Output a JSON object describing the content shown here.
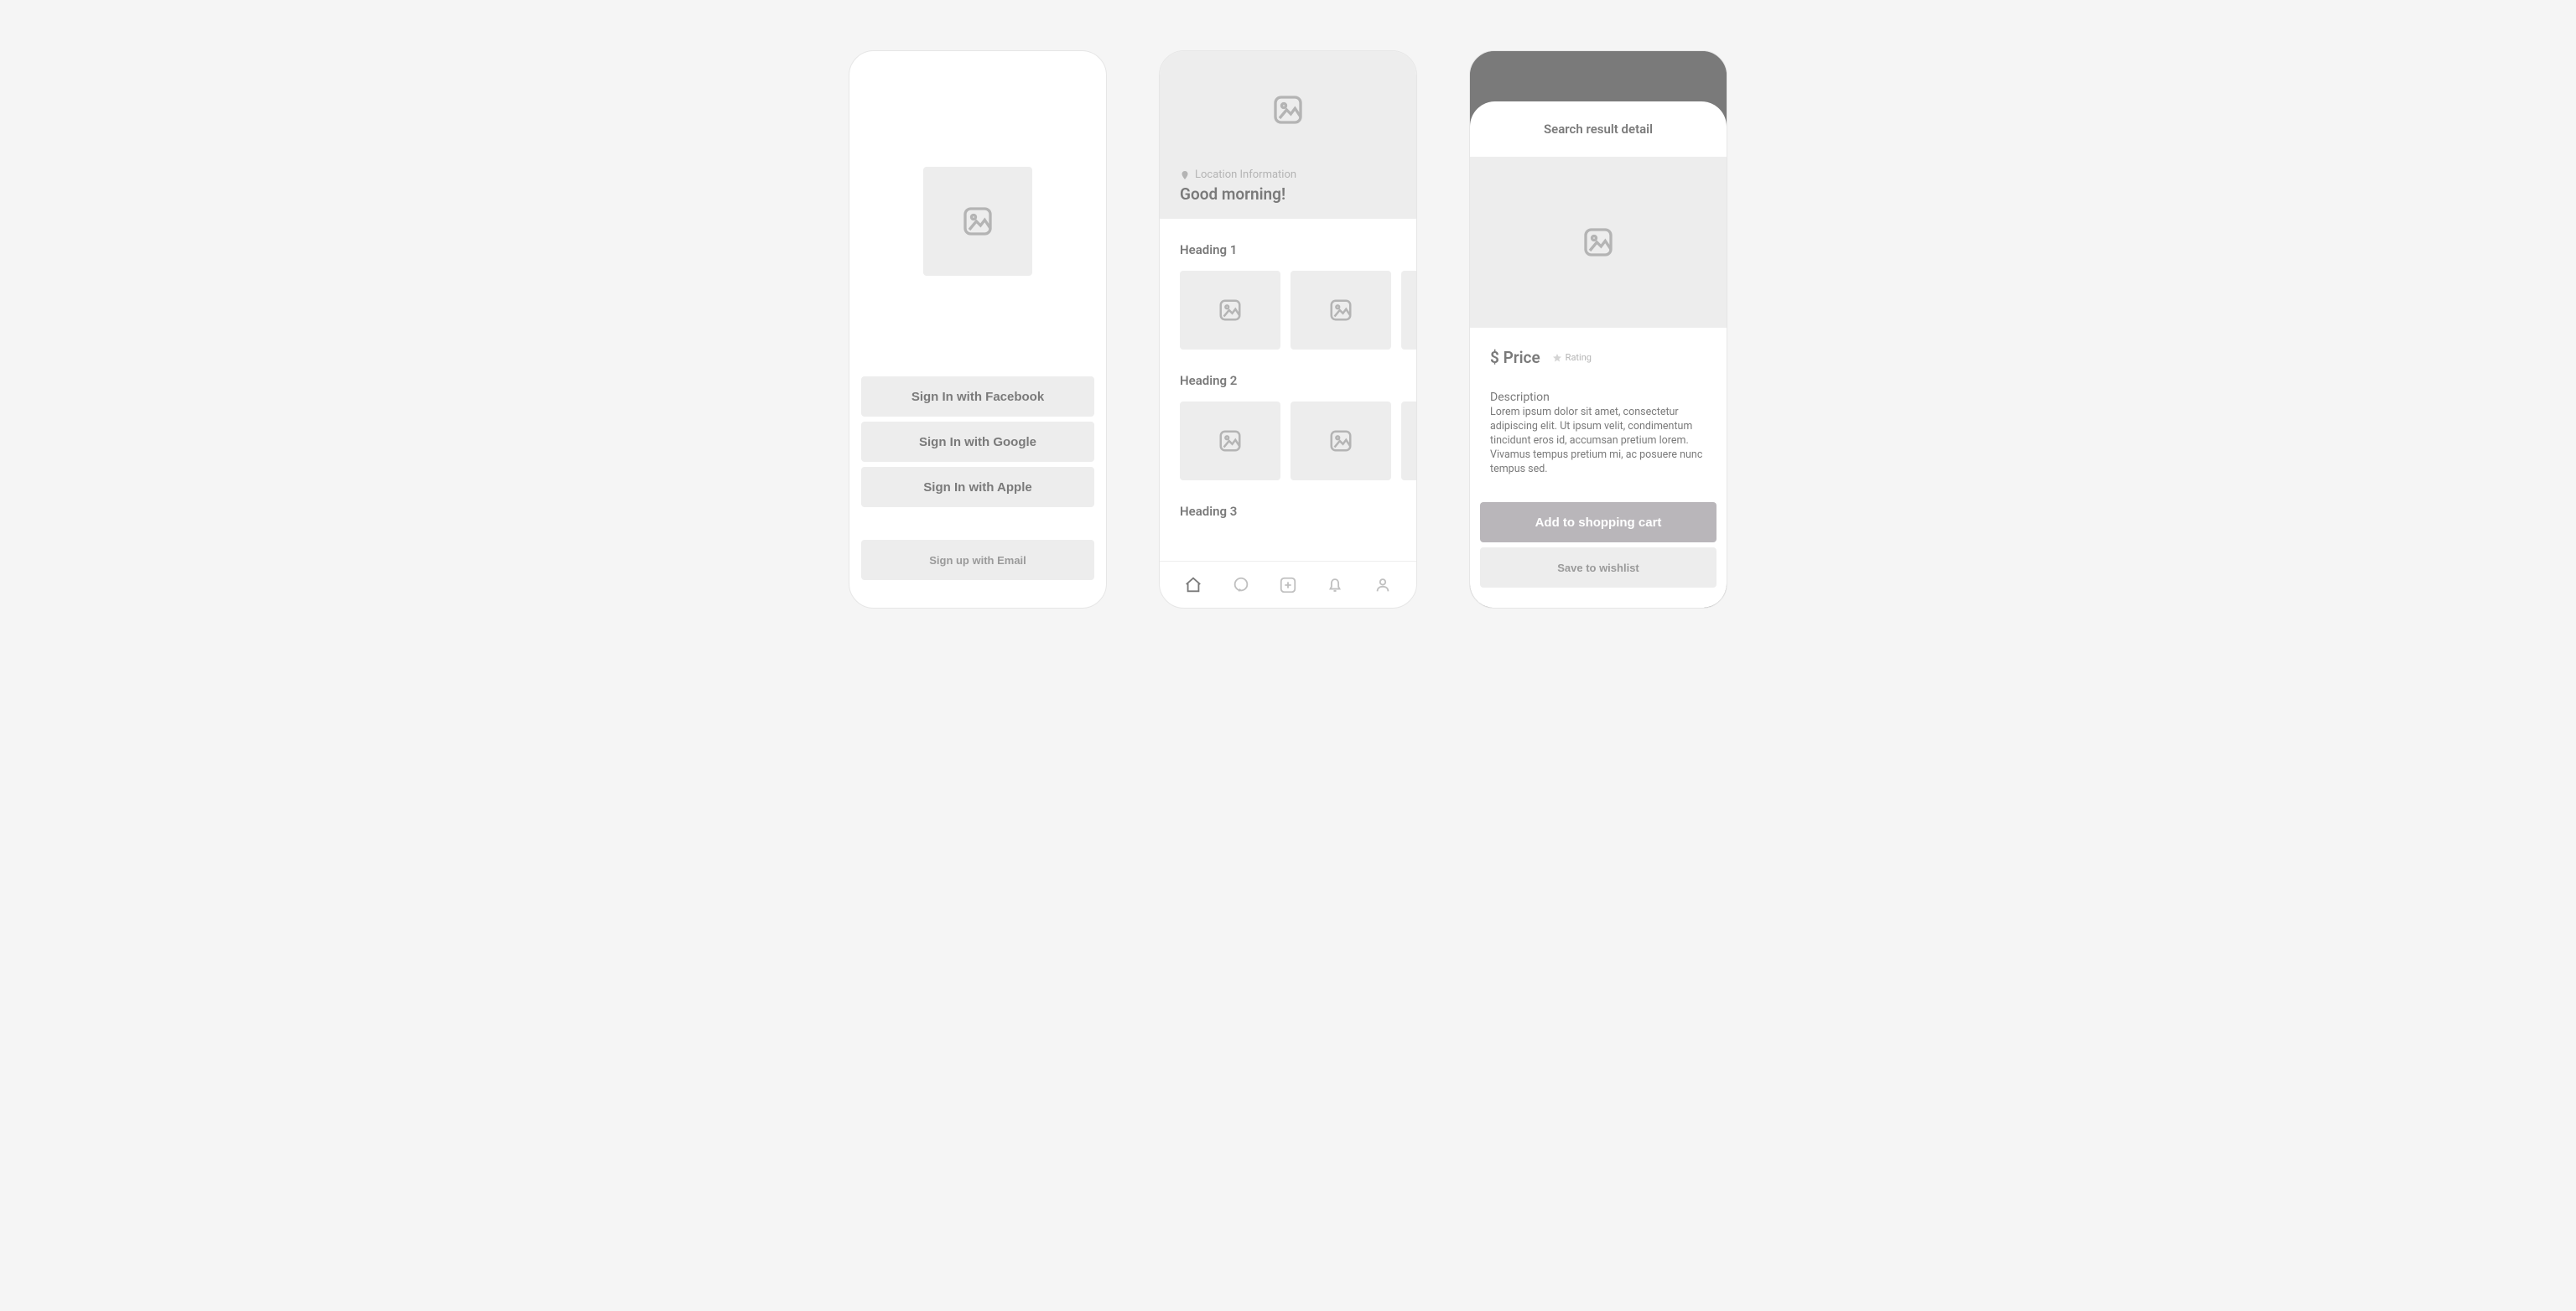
{
  "screen1": {
    "buttons": {
      "facebook": "Sign In with Facebook",
      "google": "Sign In with Google",
      "apple": "Sign In with Apple",
      "email": "Sign up with Email"
    }
  },
  "screen2": {
    "location_label": "Location Information",
    "greeting": "Good morning!",
    "sections": {
      "h1": "Heading 1",
      "h2": "Heading 2",
      "h3": "Heading 3"
    }
  },
  "screen3": {
    "title": "Search result detail",
    "price": "$ Price",
    "rating_label": "Rating",
    "description_label": "Description",
    "description": "Lorem ipsum dolor sit amet, consectetur adipiscing elit. Ut ipsum velit, condimentum tincidunt eros id, accumsan pretium lorem. Vivamus tempus pretium mi, ac posuere nunc tempus sed.",
    "add_to_cart": "Add to shopping cart",
    "save_wishlist": "Save to wishlist"
  }
}
